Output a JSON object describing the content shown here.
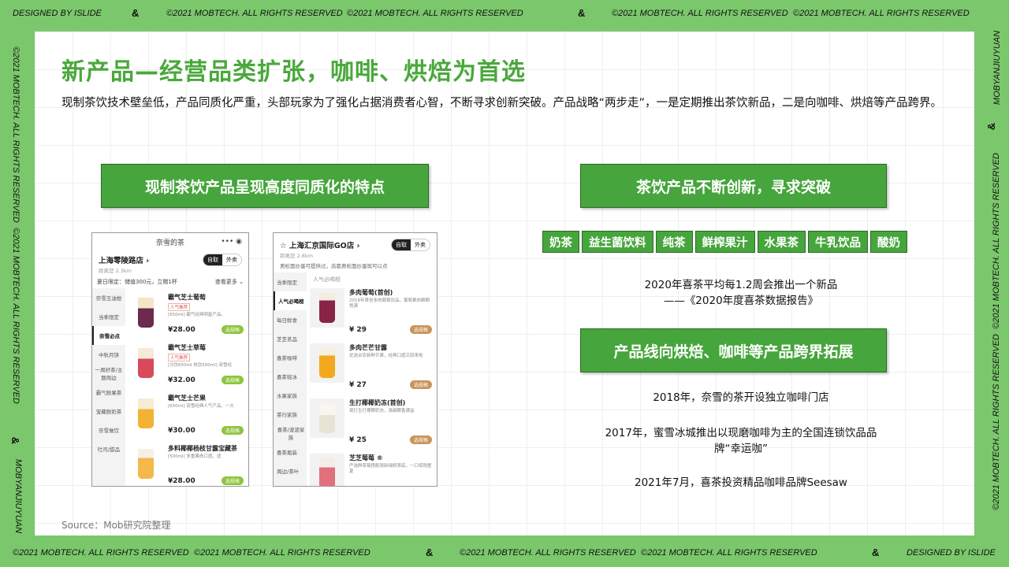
{
  "frame": {
    "top_left": "DESIGNED BY ISLIDE",
    "top_amp": "&",
    "top_copy_1": "©2021 MOBTECH. ALL RIGHTS RESERVED",
    "top_copy_2": "©2021 MOBTECH. ALL RIGHTS RESERVED",
    "top_amp2": "&",
    "top_copy_3": "©2021 MOBTECH. ALL RIGHTS RESERVED",
    "top_copy_4": "©2021 MOBTECH. ALL RIGHTS RESERVED",
    "bottom_copy_1": "©2021 MOBTECH. ALL RIGHTS RESERVED",
    "bottom_copy_2": "©2021 MOBTECH. ALL RIGHTS RESERVED",
    "bottom_amp": "&",
    "bottom_copy_3": "©2021 MOBTECH. ALL RIGHTS RESERVED",
    "bottom_copy_4": "©2021 MOBTECH. ALL RIGHTS RESERVED",
    "bottom_amp2": "&",
    "bottom_right": "DESIGNED BY ISLIDE",
    "left_copy_1": "©2021 MOBTECH. ALL RIGHTS RESERVED",
    "left_copy_2": "©2021 MOBTECH. ALL RIGHTS RESERVED",
    "left_amp": "&",
    "left_brand": "MOBYANJIUYUAN",
    "right_brand": "MOBYANJIUYUAN",
    "right_amp": "&",
    "right_copy_1": "©2021 MOBTECH. ALL RIGHTS RESERVED",
    "right_copy_2": "©2021 MOBTECH. ALL RIGHTS RESERVED"
  },
  "slide": {
    "title": "新产品—经营品类扩张，咖啡、烘焙为首选",
    "intro": "现制茶饮技术壁垒低，产品同质化严重，头部玩家为了强化占据消费者心智，不断寻求创新突破。产品战略“两步走”，一是定期推出茶饮新品，二是向咖啡、烘焙等产品跨界。",
    "left_heading": "现制茶饮产品呈现高度同质化的特点",
    "right_heading_1": "茶饮产品不断创新，寻求突破",
    "tags": [
      "奶茶",
      "益生菌饮料",
      "纯茶",
      "鲜榨果汁",
      "水果茶",
      "牛乳饮品",
      "酸奶"
    ],
    "note_1_line1": "2020年喜茶平均每1.2周会推出一个新品",
    "note_1_line2": "——《2020年度喜茶数据报告》",
    "right_heading_2": "产品线向烘焙、咖啡等产品跨界拓展",
    "note_2": "2018年，奈雪的茶开设独立咖啡门店",
    "note_3_line1": "2017年，蜜雪冰城推出以现磨咖啡为主的全国连锁饮品品",
    "note_3_line2": "牌“幸运咖”",
    "note_4": "2021年7月，喜茶投资精品咖啡品牌Seesaw",
    "source": "Source：Mob研究院整理"
  },
  "phone1": {
    "app_title": "奈雪的茶",
    "store": "上海零陵路店 ›",
    "distance": "距离您 2.3km",
    "seg_self": "自取",
    "seg_delivery": "外卖",
    "banner_left": "夏日限定：储值300元，立赠1杯",
    "banner_right": "查看更多 ⌄",
    "categories": [
      "奈雪玉油柑",
      "当季限定",
      "奈雪必点",
      "中秋月饼",
      "一周好茶/主题周边",
      "霸气鲜果茶",
      "宝藏鲜奶茶",
      "奈雪做饮",
      "吐司/甜品"
    ],
    "items": [
      {
        "name": "霸气芝士葡萄",
        "badge": "人气推荐",
        "desc": "[650ml] 霸气经典明星产品。",
        "price": "¥28.00",
        "btn": "选规格"
      },
      {
        "name": "霸气芝士草莓",
        "badge": "人气推荐",
        "desc": "[冷饮650ml 热饮500ml] 亲雪经",
        "price": "¥32.00",
        "btn": "选规格"
      },
      {
        "name": "霸气芝士芒果",
        "badge": "",
        "desc": "[650ml] 奈雪经典人气产品，一大",
        "price": "¥30.00",
        "btn": "选规格"
      },
      {
        "name": "多料椰椰杨枝甘露宝藏茶",
        "badge": "",
        "desc": "[500ml] 多重果肉口感，适",
        "price": "¥28.00",
        "btn": "选规格"
      }
    ]
  },
  "phone2": {
    "store": "☆ 上海汇京国际GO店 ›",
    "distance": "距离您 2.8km",
    "seg_self": "自取",
    "seg_delivery": "外卖",
    "notice": "奥松面炒蛋可提供过，店都奥松面炒蛋现可以点",
    "section": "人气必喝榜",
    "categories": [
      "当季限定",
      "人气必喝榜",
      "每日鲜食",
      "芝芝茗品",
      "喜茶咖啡",
      "喜茶轻冰",
      "水果家族",
      "茶行家族",
      "喜茶/波波家族",
      "喜茶瓶装",
      "周边/茶叶"
    ],
    "items": [
      {
        "name": "多肉葡萄(首创)",
        "desc": "2018年首创多肉葡萄饮品，葡萄果肉颗颗饱满",
        "price": "¥ 29",
        "btn": "选规格"
      },
      {
        "name": "多肉芒芒甘露",
        "desc": "优选台农新鲜芒果，经典口感又回来啦",
        "price": "¥ 27",
        "btn": "选规格"
      },
      {
        "name": "生打椰椰奶冻(首创)",
        "desc": "现打生打椰椰奶冻，清甜椰香满溢",
        "price": "¥ 25",
        "btn": "选规格"
      },
      {
        "name": "芝芝莓莓 ®",
        "desc": "严选鲜草莓搭配清新绿妍茶底，一口惊艳整夏",
        "price": "",
        "btn": ""
      }
    ]
  }
}
